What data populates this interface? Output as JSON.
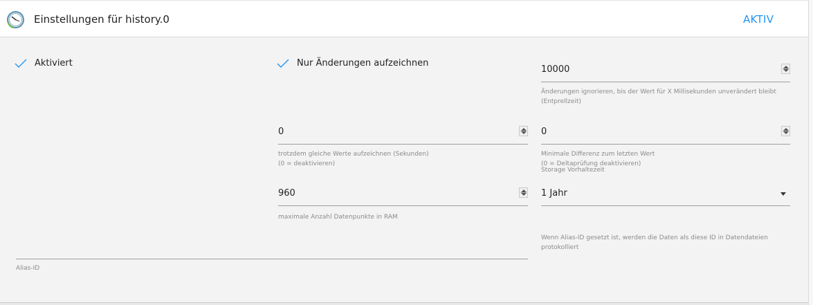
{
  "header": {
    "title": "Einstellungen für history.0",
    "tab_label": "AKTIV",
    "icon": "clock-icon"
  },
  "colors": {
    "accent": "#2196f3",
    "check": "#2196f3"
  },
  "settings": {
    "enabled": {
      "label": "Aktiviert",
      "checked": true
    },
    "changes_only": {
      "label": "Nur Änderungen aufzeichnen",
      "checked": true
    },
    "debounce": {
      "value": "10000",
      "help": "Änderungen ignorieren, bis der Wert für X Millisekunden unverändert bleibt\n(Entprellzeit)"
    },
    "same_values": {
      "value": "0",
      "help": "trotzdem gleiche Werte aufzeichnen (Sekunden)\n(0 = deaktivieren)"
    },
    "min_diff": {
      "value": "0",
      "help": "Minimale Differenz zum letzten Wert\n(0 = Deltaprüfung deaktivieren)"
    },
    "max_points": {
      "value": "960",
      "help": "maximale Anzahl Datenpunkte in RAM"
    },
    "retention": {
      "label": "Storage Vorhaltezeit",
      "value": "1 Jahr"
    },
    "alias": {
      "label": "Alias-ID",
      "value": "",
      "help": "Wenn Alias-ID gesetzt ist, werden die Daten als diese ID in Datendateien\nprotokolliert"
    }
  }
}
